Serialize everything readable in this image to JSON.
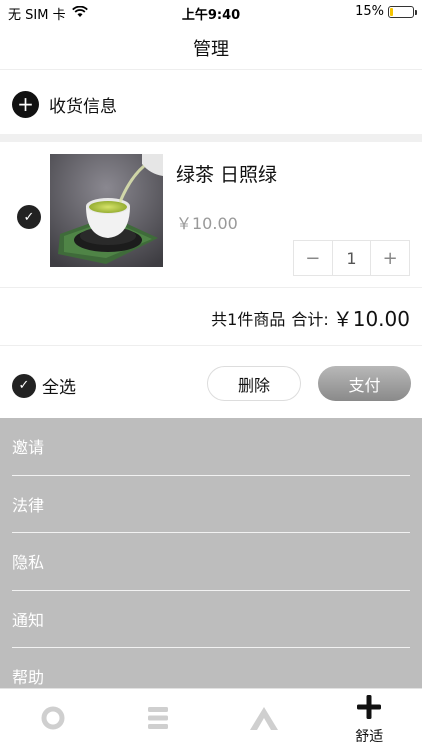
{
  "status_bar": {
    "carrier": "无 SIM 卡",
    "time": "上午9:40",
    "battery_percent": "15%",
    "battery_level": 0.15
  },
  "nav": {
    "title": "管理"
  },
  "address": {
    "label": "收货信息",
    "icon": "plus-circle-icon"
  },
  "cart": {
    "items": [
      {
        "name": "绿茶 日照绿",
        "price": "￥10.00",
        "quantity": "1",
        "selected": true
      }
    ],
    "stepper": {
      "minus": "−",
      "plus": "+"
    }
  },
  "summary": {
    "count_text": "共1件商品",
    "total_label": "合计:",
    "total_value": "￥10.00"
  },
  "actions": {
    "select_all": "全选",
    "delete": "删除",
    "pay": "支付"
  },
  "menu": {
    "items": [
      "邀请",
      "法律",
      "隐私",
      "通知",
      "帮助"
    ]
  },
  "tabs": [
    {
      "icon": "circle-icon",
      "label": ""
    },
    {
      "icon": "menu-icon",
      "label": ""
    },
    {
      "icon": "mountain-icon",
      "label": ""
    },
    {
      "icon": "plus-icon",
      "label": "舒适",
      "active": true
    }
  ],
  "colors": {
    "menu_background": "#bdbdbd",
    "pay_button": "#9e9e9e",
    "battery_fill": "#f5c400",
    "check": "#222222"
  }
}
